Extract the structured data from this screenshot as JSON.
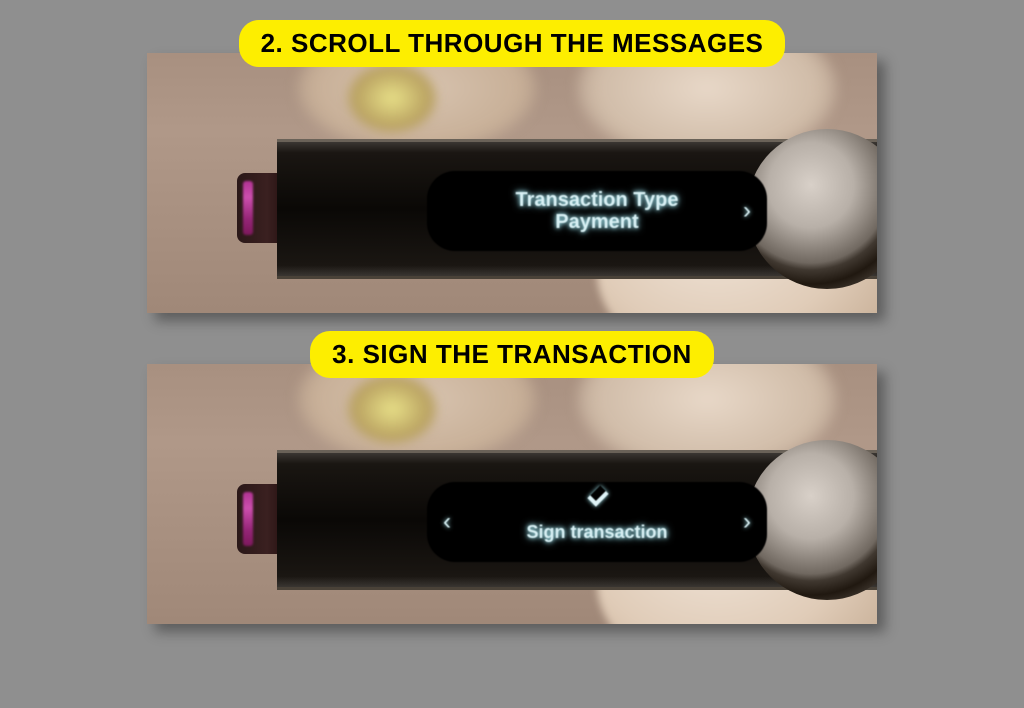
{
  "captions": {
    "step2": "2. Scroll through the messages",
    "step3": "3. Sign the transaction"
  },
  "screen1": {
    "line1": "Transaction Type",
    "line2": "Payment"
  },
  "screen2": {
    "label": "Sign transaction"
  }
}
